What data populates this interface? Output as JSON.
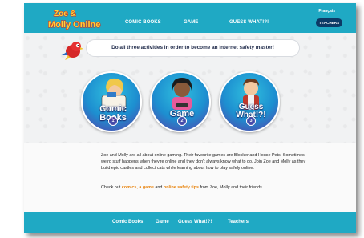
{
  "header": {
    "logo_line1": "Zoe &",
    "logo_line2": "Molly Online",
    "nav": [
      "COMIC BOOKS",
      "GAME",
      "GUESS WHAT!?!"
    ],
    "language_link": "Français",
    "teachers_button": "TEACHERS"
  },
  "banner": {
    "text": "Do all three activities in order to become an internet safety master!"
  },
  "activities": [
    {
      "line1": "Comic",
      "line2": "Books",
      "number": "1"
    },
    {
      "line1": "Game",
      "line2": "",
      "number": "2"
    },
    {
      "line1": "Guess",
      "line2": "What!?!",
      "number": "3"
    }
  ],
  "intro": {
    "paragraph": "Zoe and Molly are all about online gaming. Their favourite games are Blocker and House Pets. Sometimes weird stuff happens when they're online and they don't always know what to do. Join Zoe and Molly as they build epic castles and collect cats while learning about how to play safely online.",
    "checkout_prefix": "Check out ",
    "link_comics": "comics, a game",
    "checkout_and": " and ",
    "link_tips": "online safety tips",
    "checkout_suffix": " from Zoe, Molly and their friends."
  },
  "footer": {
    "items": [
      "Comic Books",
      "Game",
      "Guess What!?!",
      "Teachers"
    ]
  },
  "colors": {
    "header_bg": "#1fa9c4",
    "accent_orange": "#e8840e",
    "teachers_pill": "#0c3a66"
  }
}
